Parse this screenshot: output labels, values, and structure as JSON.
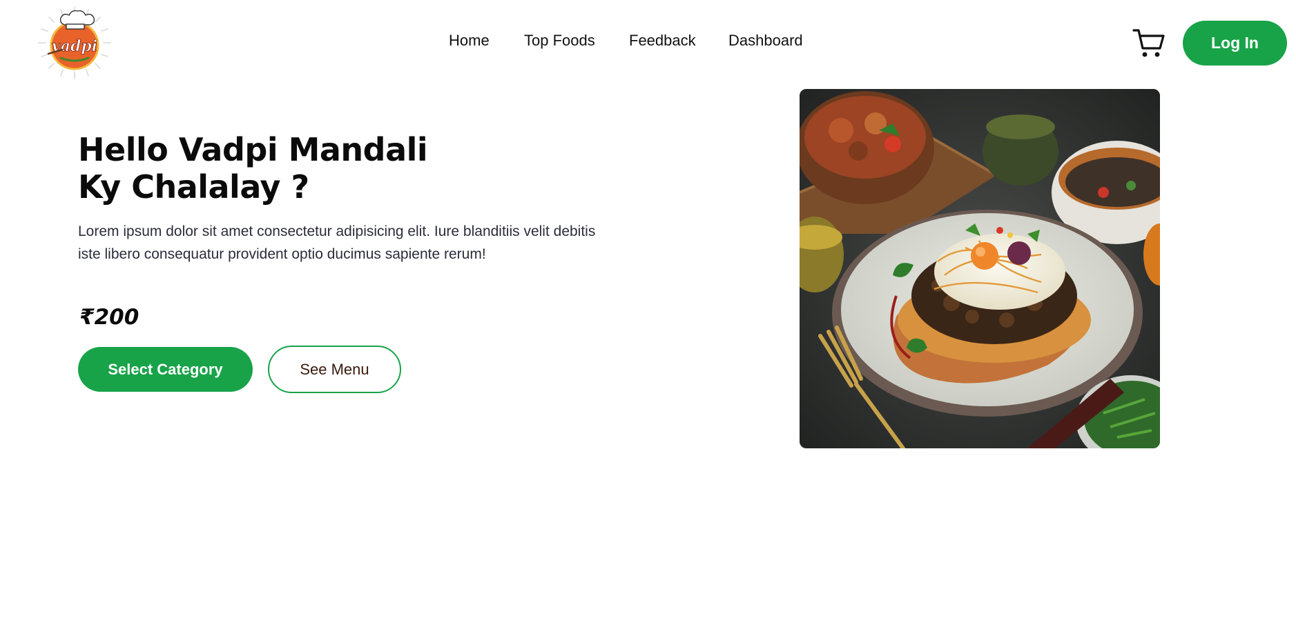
{
  "brand": {
    "logo_text": "vadpi",
    "logo_icon": "chef-hat-logo-icon"
  },
  "nav": {
    "items": [
      {
        "label": "Home"
      },
      {
        "label": "Top Foods"
      },
      {
        "label": "Feedback"
      },
      {
        "label": "Dashboard"
      }
    ]
  },
  "header": {
    "cart_icon": "cart-icon",
    "login_label": "Log In"
  },
  "hero": {
    "title_line1": "Hello Vadpi Mandali",
    "title_line2": "Ky Chalalay ?",
    "description": "Lorem ipsum dolor sit amet consectetur adipisicing elit. Iure blanditiis velit debitis iste libero consequatur provident optio ducimus sapiente rerum!",
    "price": "₹200",
    "primary_button": "Select Category",
    "secondary_button": "See Menu",
    "image_subject": "plated-dish-photo"
  },
  "colors": {
    "accent_green": "#18a349",
    "text_dark": "#0b0b0b",
    "secondary_button_text": "#3a1a0e"
  }
}
